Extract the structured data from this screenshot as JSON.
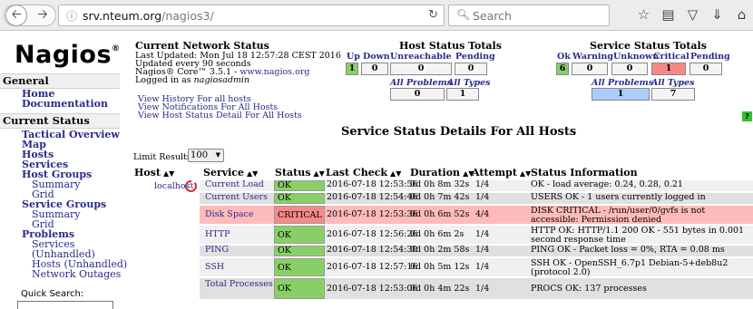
{
  "browser": {
    "url_host": "srv.nteum.org",
    "url_path": "/nagios3/",
    "search_placeholder": "Search",
    "icons": [
      "star-icon",
      "reading-list-icon",
      "pocket-icon",
      "download-icon",
      "home-icon",
      "menu-icon"
    ]
  },
  "sidebar": {
    "logo": "Nagios",
    "logo_mark": "®",
    "general_heading": "General",
    "general_items": [
      "Home",
      "Documentation"
    ],
    "current_status_heading": "Current Status",
    "items": {
      "tactical": "Tactical Overview",
      "map": "Map",
      "hosts": "Hosts",
      "services": "Services",
      "host_groups": "Host Groups",
      "hg_summary": "Summary",
      "hg_grid": "Grid",
      "service_groups": "Service Groups",
      "sg_summary": "Summary",
      "sg_grid": "Grid",
      "problems": "Problems",
      "p_services": "Services",
      "p_unhandled_svc": "(Unhandled)",
      "p_hosts": "Hosts",
      "p_unhandled_hosts": "(Unhandled)",
      "p_network_outages": "Network Outages"
    },
    "quick_search_label": "Quick Search:"
  },
  "status": {
    "title": "Current Network Status",
    "last_updated": "Last Updated: Mon Jul 18 12:57:28 CEST 2016",
    "update_interval": "Updated every 90 seconds",
    "core_prefix": "Nagios® Core™ 3.5.1 - ",
    "core_link": "www.nagios.org",
    "logged_in_prefix": "Logged in as ",
    "logged_in_user": "nagiosadmin",
    "links": [
      "View History For all hosts",
      "View Notifications For All Hosts",
      "View Host Status Detail For All Hosts"
    ]
  },
  "host_totals": {
    "title": "Host Status Totals",
    "headers": [
      "Up",
      "Down",
      "Unreachable",
      "Pending"
    ],
    "values": [
      "1",
      "0",
      "0",
      "0"
    ],
    "sub_headers": [
      "All Problems",
      "All Types"
    ],
    "sub_values": [
      "0",
      "1"
    ]
  },
  "service_totals": {
    "title": "Service Status Totals",
    "headers": [
      "Ok",
      "Warning",
      "Unknown",
      "Critical",
      "Pending"
    ],
    "values": [
      "6",
      "0",
      "0",
      "1",
      "0"
    ],
    "sub_headers": [
      "All Problems",
      "All Types"
    ],
    "sub_values": [
      "1",
      "7"
    ]
  },
  "help_label": "?",
  "details": {
    "title": "Service Status Details For All Hosts",
    "limit_label": "Limit Results:",
    "limit_value": "100",
    "columns": [
      "Host",
      "Service",
      "Status",
      "Last Check",
      "Duration",
      "Attempt",
      "Status Information"
    ],
    "host": "localhost",
    "rows": [
      {
        "service": "Current Load",
        "status": "OK",
        "last_check": "2016-07-18 12:53:56",
        "duration": "0d 0h 8m 32s",
        "attempt": "1/4",
        "info": "OK - load average: 0.24, 0.28, 0.21"
      },
      {
        "service": "Current Users",
        "status": "OK",
        "last_check": "2016-07-18 12:54:46",
        "duration": "0d 0h 7m 42s",
        "attempt": "1/4",
        "info": "USERS OK - 1 users currently logged in"
      },
      {
        "service": "Disk Space",
        "status": "CRITICAL",
        "last_check": "2016-07-18 12:53:36",
        "duration": "0d 0h 6m 52s",
        "attempt": "4/4",
        "info": "DISK CRITICAL - /run/user/0/gvfs is not accessible: Permission denied"
      },
      {
        "service": "HTTP",
        "status": "OK",
        "last_check": "2016-07-18 12:56:26",
        "duration": "0d 0h 6m 2s",
        "attempt": "1/4",
        "info": "HTTP OK: HTTP/1.1 200 OK - 551 bytes in 0.001 second response time"
      },
      {
        "service": "PING",
        "status": "OK",
        "last_check": "2016-07-18 12:54:30",
        "duration": "0d 0h 2m 58s",
        "attempt": "1/4",
        "info": "PING OK - Packet loss = 0%, RTA = 0.08 ms"
      },
      {
        "service": "SSH",
        "status": "OK",
        "last_check": "2016-07-18 12:57:16",
        "duration": "0d 0h 5m 12s",
        "attempt": "1/4",
        "info": "SSH OK - OpenSSH_6.7p1 Debian-5+deb8u2 (protocol 2.0)"
      },
      {
        "service": "Total Processes",
        "status": "OK",
        "last_check": "2016-07-18 12:53:06",
        "duration": "0d 0h 4m 22s",
        "attempt": "1/4",
        "info": "PROCS OK: 137 processes"
      }
    ]
  }
}
